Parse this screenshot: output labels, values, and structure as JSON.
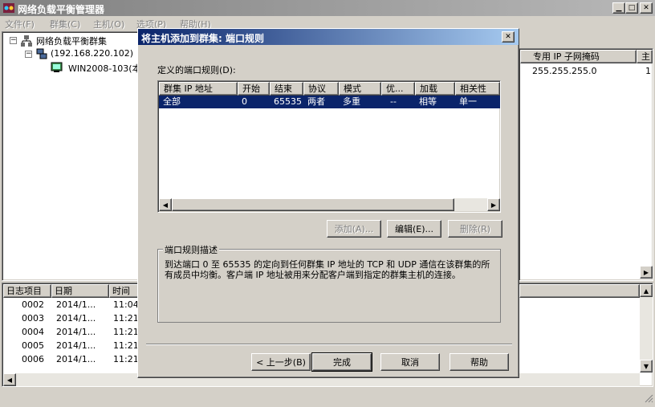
{
  "main_window": {
    "title": "网络负载平衡管理器",
    "menu": [
      "文件(F)",
      "群集(C)",
      "主机(O)",
      "选项(P)",
      "帮助(H)"
    ],
    "tree": {
      "root": "网络负载平衡群集",
      "cluster": "(192.168.220.102)",
      "host": "WIN2008-103(本"
    },
    "right_headers": {
      "subnet": "专用 IP 子网掩码",
      "pri": "主"
    },
    "right_row": {
      "subnet": "255.255.255.0",
      "pri": "1"
    },
    "log": {
      "headers": [
        "日志项目",
        "日期",
        "时间"
      ],
      "rows": [
        [
          "0002",
          "2014/1...",
          "11:04"
        ],
        [
          "0003",
          "2014/1...",
          "11:21"
        ],
        [
          "0004",
          "2014/1...",
          "11:21"
        ],
        [
          "0005",
          "2014/1...",
          "11:21"
        ],
        [
          "0006",
          "2014/1...",
          "11:21"
        ]
      ]
    }
  },
  "dialog": {
    "title": "将主机添加到群集: 端口规则",
    "rules_label": "定义的端口规则(D):",
    "columns": [
      "群集 IP 地址",
      "开始",
      "结束",
      "协议",
      "模式",
      "优...",
      "加载",
      "相关性"
    ],
    "rows": [
      [
        "全部",
        "0",
        "65535",
        "两者",
        "多重",
        "--",
        "相等",
        "单一"
      ]
    ],
    "buttons": {
      "add": "添加(A)...",
      "edit": "编辑(E)...",
      "remove": "删除(R)"
    },
    "description_title": "端口规则描述",
    "description": "到达端口 0 至 65535 的定向到任何群集 IP 地址的 TCP 和 UDP 通信在该群集的所有成员中均衡。客户端 IP 地址被用来分配客户端到指定的群集主机的连接。",
    "nav": {
      "back": "< 上一步(B)",
      "finish": "完成",
      "cancel": "取消",
      "help": "帮助"
    }
  },
  "icons": [
    "app-icon",
    "cluster-icon",
    "host-icon",
    "close-icon",
    "minimize-icon",
    "maximize-icon",
    "scroll-arrow-icon",
    "resize-grip-icon"
  ]
}
